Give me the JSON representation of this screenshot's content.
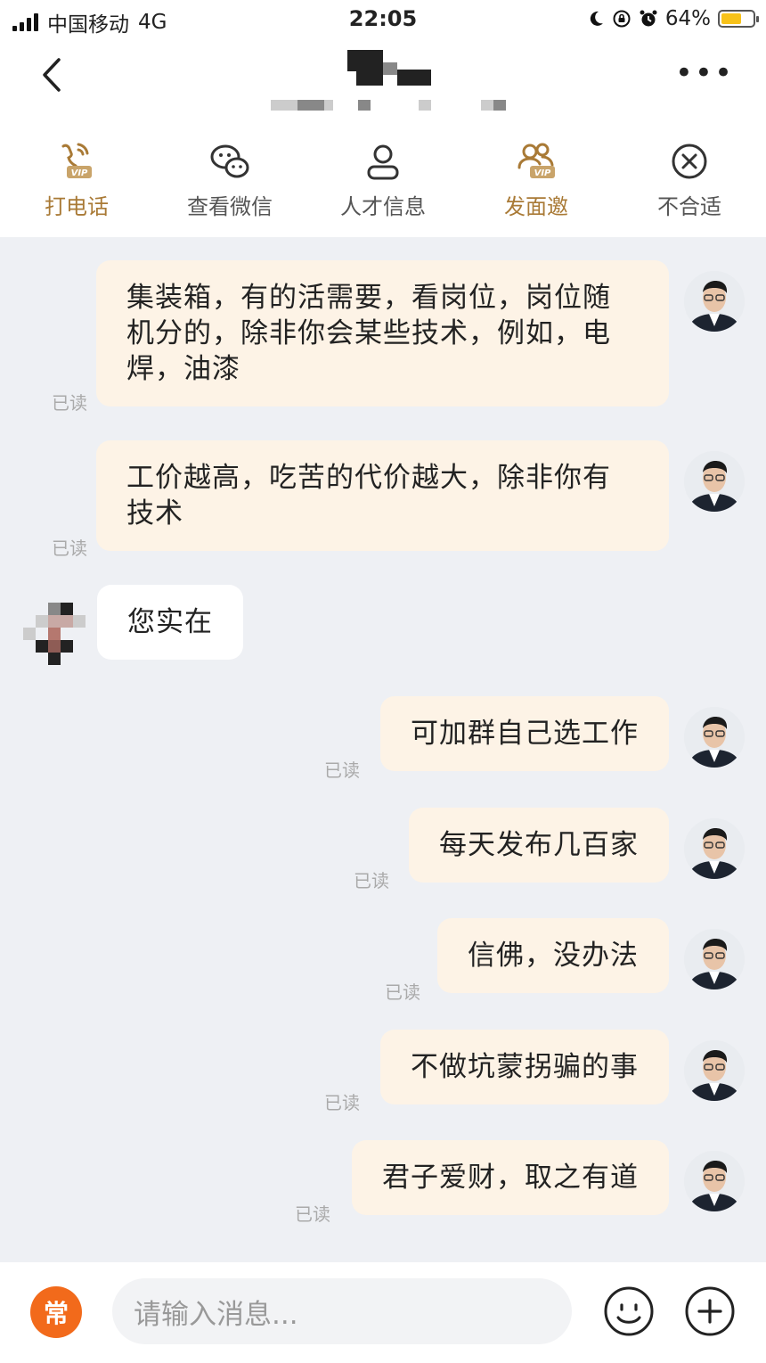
{
  "status": {
    "carrier": "中国移动",
    "network": "4G",
    "time": "22:05",
    "battery": "64%",
    "battery_level": 0.64
  },
  "actions": [
    {
      "label": "打电话",
      "icon": "phone-vip-icon",
      "highlight": true
    },
    {
      "label": "查看微信",
      "icon": "wechat-icon",
      "highlight": false
    },
    {
      "label": "人才信息",
      "icon": "person-icon",
      "highlight": false
    },
    {
      "label": "发面邀",
      "icon": "interview-vip-icon",
      "highlight": true
    },
    {
      "label": "不合适",
      "icon": "close-circle-icon",
      "highlight": false
    }
  ],
  "messages": [
    {
      "from": "me",
      "text": "集装箱，有的活需要，看岗位，岗位随机分的，除非你会某些技术，例如，电焊，油漆",
      "status": "已读"
    },
    {
      "from": "me",
      "text": "工价越高，吃苦的代价越大，除非你有技术",
      "status": "已读"
    },
    {
      "from": "them",
      "text": "您实在"
    },
    {
      "from": "me",
      "text": "可加群自己选工作",
      "status": "已读"
    },
    {
      "from": "me",
      "text": "每天发布几百家",
      "status": "已读"
    },
    {
      "from": "me",
      "text": "信佛，没办法",
      "status": "已读"
    },
    {
      "from": "me",
      "text": "不做坑蒙拐骗的事",
      "status": "已读"
    },
    {
      "from": "me",
      "text": "君子爱财，取之有道",
      "status": "已读"
    }
  ],
  "input": {
    "quick_label": "常",
    "placeholder": "请输入消息..."
  },
  "colors": {
    "accent": "#f26a1b",
    "gold": "#a97a36",
    "my_bubble": "#fdf3e6",
    "background": "#eef0f4"
  }
}
